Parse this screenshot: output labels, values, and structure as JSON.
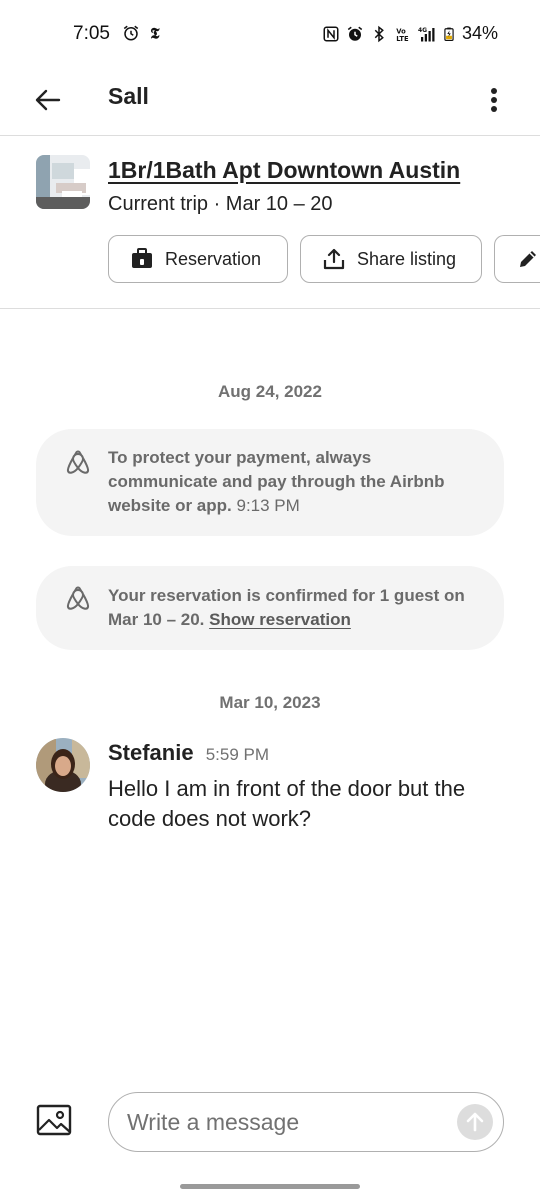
{
  "status_bar": {
    "time": "7:05",
    "battery": "34%",
    "left_icons": [
      "alarm-icon",
      "nyt-icon"
    ],
    "right_icons": [
      "nfc-icon",
      "alarm-icon",
      "bluetooth-icon",
      "volte-icon",
      "signal-4g-icon",
      "battery-icon"
    ]
  },
  "header": {
    "title": "Sall",
    "back_icon": "back-arrow-icon",
    "more_icon": "more-vertical-icon"
  },
  "listing": {
    "title": "1Br/1Bath Apt  Downtown Austin",
    "subtitle": "Current trip · Mar 10 – 20",
    "chips": {
      "reservation": "Reservation",
      "share": "Share listing"
    }
  },
  "thread": {
    "date1": "Aug 24, 2022",
    "system1": {
      "text": "To protect your payment, always communicate and pay through the Airbnb website or app.",
      "time": "9:13 PM"
    },
    "system2": {
      "text": "Your reservation is confirmed for 1 guest on Mar 10 – 20.",
      "link": "Show reservation"
    },
    "date2": "Mar 10, 2023",
    "message": {
      "sender": "Stefanie",
      "time": "5:59 PM",
      "text": "Hello I am in front of the door but the code does not work?"
    }
  },
  "composer": {
    "placeholder": "Write a message"
  },
  "colors": {
    "text": "#222222",
    "muted": "#717171",
    "card": "#f4f4f4",
    "border": "#b0b0b0"
  }
}
